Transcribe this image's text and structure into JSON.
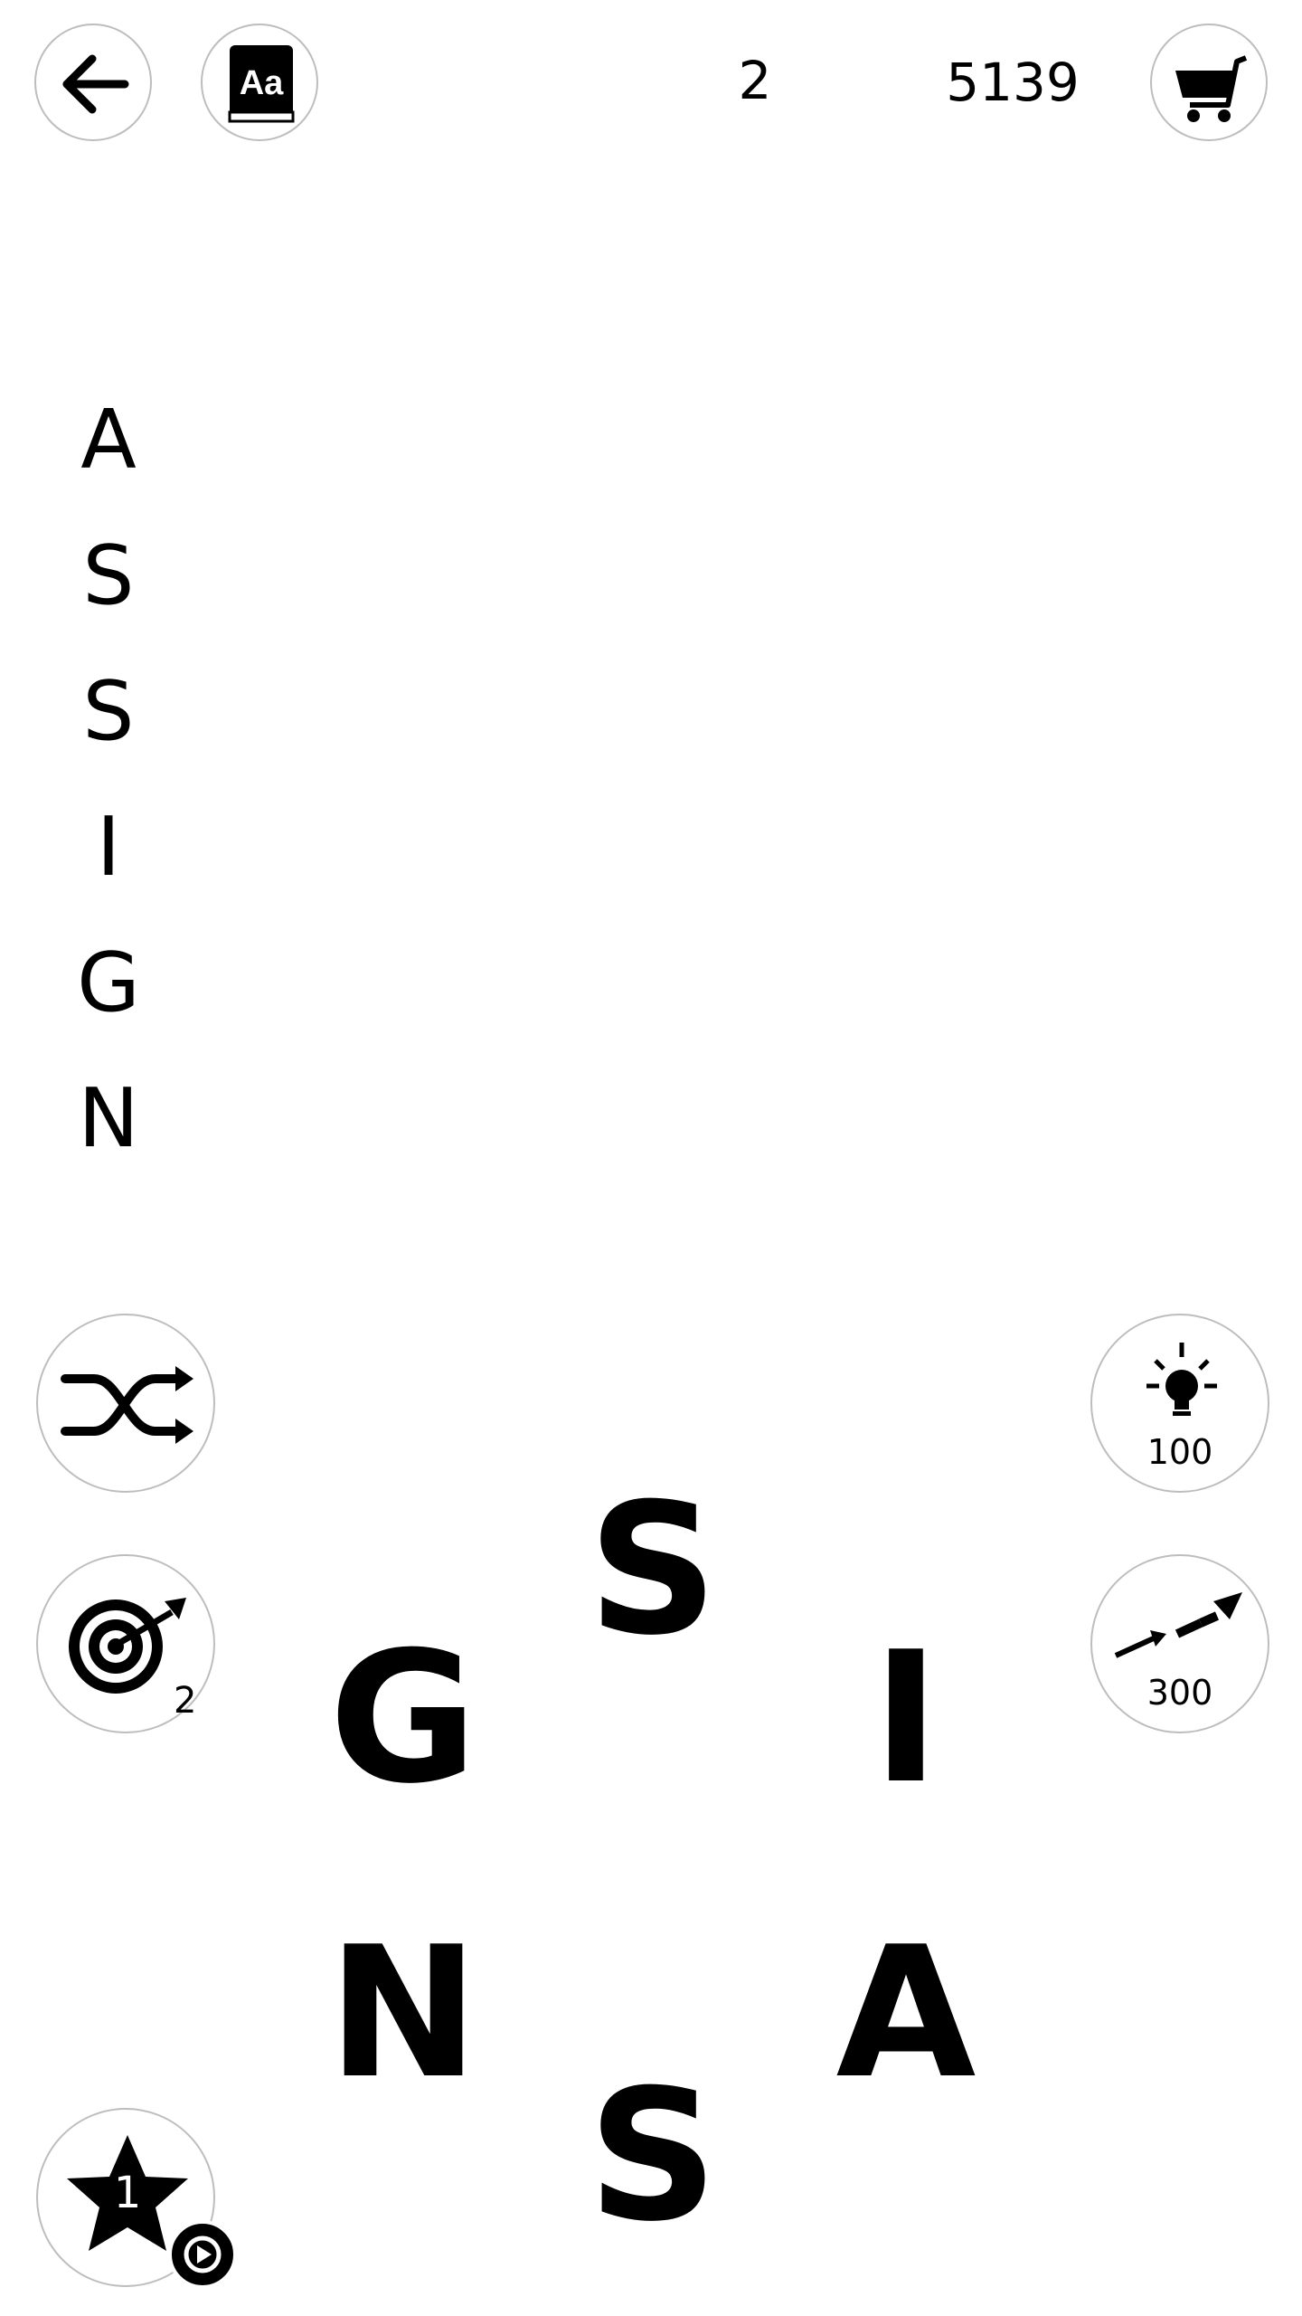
{
  "header": {
    "level": "2",
    "coins": "5139"
  },
  "found_word": {
    "letters": [
      "A",
      "S",
      "S",
      "I",
      "G",
      "N"
    ]
  },
  "wheel": {
    "letters": [
      "S",
      "G",
      "I",
      "N",
      "A",
      "S"
    ]
  },
  "actions": {
    "target_count": "2",
    "hint_cost": "100",
    "rocket_cost": "300",
    "star_count": "1"
  },
  "icons": {
    "back": "arrow-left-icon",
    "dictionary": "dictionary-book-icon",
    "shop": "shopping-cart-icon",
    "shuffle": "shuffle-icon",
    "target": "target-dart-icon",
    "hint": "lightbulb-icon",
    "rocket": "rocket-icon",
    "star": "star-icon",
    "video": "video-ad-icon"
  }
}
